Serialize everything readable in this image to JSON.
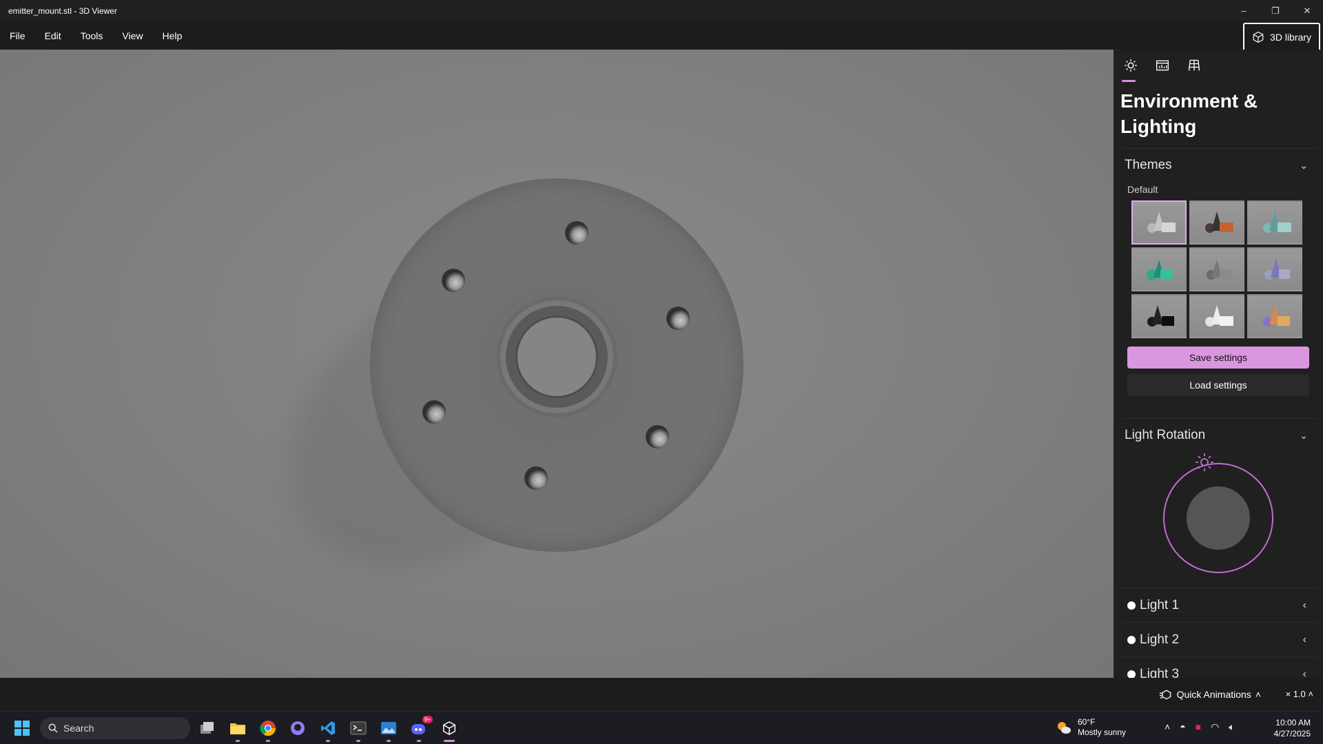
{
  "window": {
    "title": "emitter_mount.stl - 3D Viewer",
    "minimize_glyph": "–",
    "restore_glyph": "❐",
    "close_glyph": "✕"
  },
  "menu": {
    "items": [
      "File",
      "Edit",
      "Tools",
      "View",
      "Help"
    ],
    "library_label": "3D library"
  },
  "panel": {
    "tabs": [
      "sun-icon",
      "stats-icon",
      "grid-icon"
    ],
    "title": "Environment & Lighting",
    "themes": {
      "header": "Themes",
      "selected_label": "Default",
      "selected_index": 0
    },
    "save_label": "Save settings",
    "load_label": "Load settings",
    "light_rotation": {
      "header": "Light Rotation"
    },
    "lights": [
      "Light 1",
      "Light 2",
      "Light 3"
    ]
  },
  "statusbar": {
    "animations_label": "Quick Animations",
    "speed": "× 1.0"
  },
  "taskbar": {
    "search_placeholder": "Search",
    "discord_badge": "9+",
    "weather_temp": "60°F",
    "weather_desc": "Mostly sunny",
    "time": "10:00 AM",
    "date": "4/27/2025"
  },
  "colors": {
    "accent": "#d88ee0",
    "panel_bg": "#202020",
    "viewport_bg": "#828282"
  }
}
